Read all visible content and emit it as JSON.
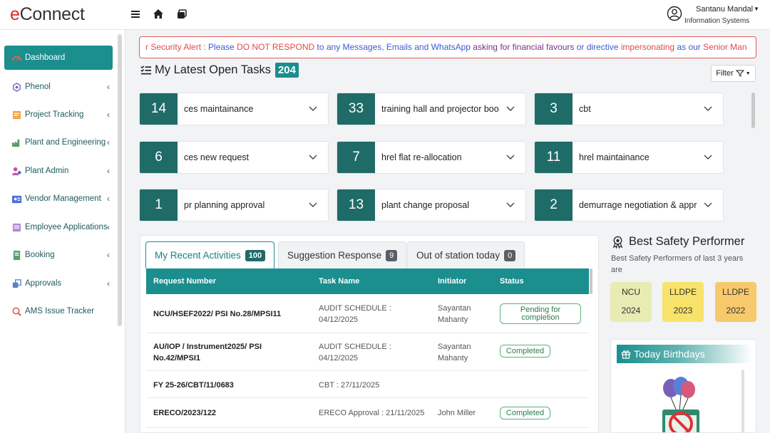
{
  "app": {
    "logo_e": "e",
    "logo_rest": "Connect"
  },
  "header": {
    "user_name": "Santanu Mandal",
    "user_dept": "Information Systems"
  },
  "sidebar": {
    "items": [
      {
        "label": "Dashboard",
        "icon": "gauge-icon",
        "active": true
      },
      {
        "label": "Phenol",
        "icon": "molecule-icon"
      },
      {
        "label": "Project Tracking",
        "icon": "tracking-icon"
      },
      {
        "label": "Plant and Engineering",
        "icon": "plant-icon"
      },
      {
        "label": "Plant Admin",
        "icon": "admin-icon"
      },
      {
        "label": "Vendor Management",
        "icon": "vendor-icon"
      },
      {
        "label": "Employee Applications",
        "icon": "employee-icon"
      },
      {
        "label": "Booking",
        "icon": "booking-icon"
      },
      {
        "label": "Approvals",
        "icon": "approvals-icon"
      },
      {
        "label": "AMS Issue Tracker",
        "icon": "tracker-icon"
      }
    ]
  },
  "alert": {
    "p1": "r Security Alert : ",
    "p2": "Please ",
    "p3": "DO NOT RESPOND",
    "p4": " to any Messages, Emails and WhatsApp ",
    "p5": "asking for financial favours",
    "p6": " or directive ",
    "p7": "impersonating",
    "p8": " as our ",
    "p9": "Senior Man"
  },
  "tasks": {
    "title": "My Latest Open Tasks",
    "count": "204",
    "filter_label": "Filter",
    "cards": [
      {
        "count": "14",
        "label": "ces maintainance"
      },
      {
        "count": "33",
        "label": "training hall and projector boo"
      },
      {
        "count": "3",
        "label": "cbt"
      },
      {
        "count": "6",
        "label": "ces new request"
      },
      {
        "count": "7",
        "label": "hrel flat re-allocation"
      },
      {
        "count": "11",
        "label": "hrel maintainance"
      },
      {
        "count": "1",
        "label": "pr planning approval"
      },
      {
        "count": "13",
        "label": "plant change proposal"
      },
      {
        "count": "2",
        "label": "demurrage negotiation & appr"
      }
    ]
  },
  "activities": {
    "tabs": [
      {
        "label": "My Recent Activities",
        "count": "100"
      },
      {
        "label": "Suggestion Response",
        "count": "9"
      },
      {
        "label": "Out of station today",
        "count": "0"
      }
    ],
    "columns": [
      "Request Number",
      "Task Name",
      "Initiator",
      "Status"
    ],
    "rows": [
      {
        "req": "NCU/HSEF2022/ PSI No.28/MPSI11",
        "task": "AUDIT SCHEDULE : 04/12/2025",
        "initiator": "Sayantan Mahanty",
        "status": "Pending for completion"
      },
      {
        "req": "AU/IOP / Instrument2025/ PSI No.42/MPSI1",
        "task": "AUDIT SCHEDULE : 04/12/2025",
        "initiator": "Sayantan Mahanty",
        "status": "Completed"
      },
      {
        "req": "FY 25-26/CBT/11/0683",
        "task": "CBT : 27/11/2025",
        "initiator": "",
        "status": ""
      },
      {
        "req": "ERECO/2023/122",
        "task": "ERECO Approval : 21/11/2025",
        "initiator": "John Miller",
        "status": "Completed"
      }
    ]
  },
  "safety": {
    "title": "Best Safety Performer",
    "subtitle": "Best Safety Performers of last 3 years are",
    "cards": [
      {
        "name": "NCU",
        "year": "2024",
        "color": "#e8ecb2"
      },
      {
        "name": "LLDPE",
        "year": "2023",
        "color": "#f7e36a"
      },
      {
        "name": "LLDPE",
        "year": "2022",
        "color": "#f7c96a"
      }
    ]
  },
  "birthdays": {
    "title": "Today Birthdays"
  }
}
